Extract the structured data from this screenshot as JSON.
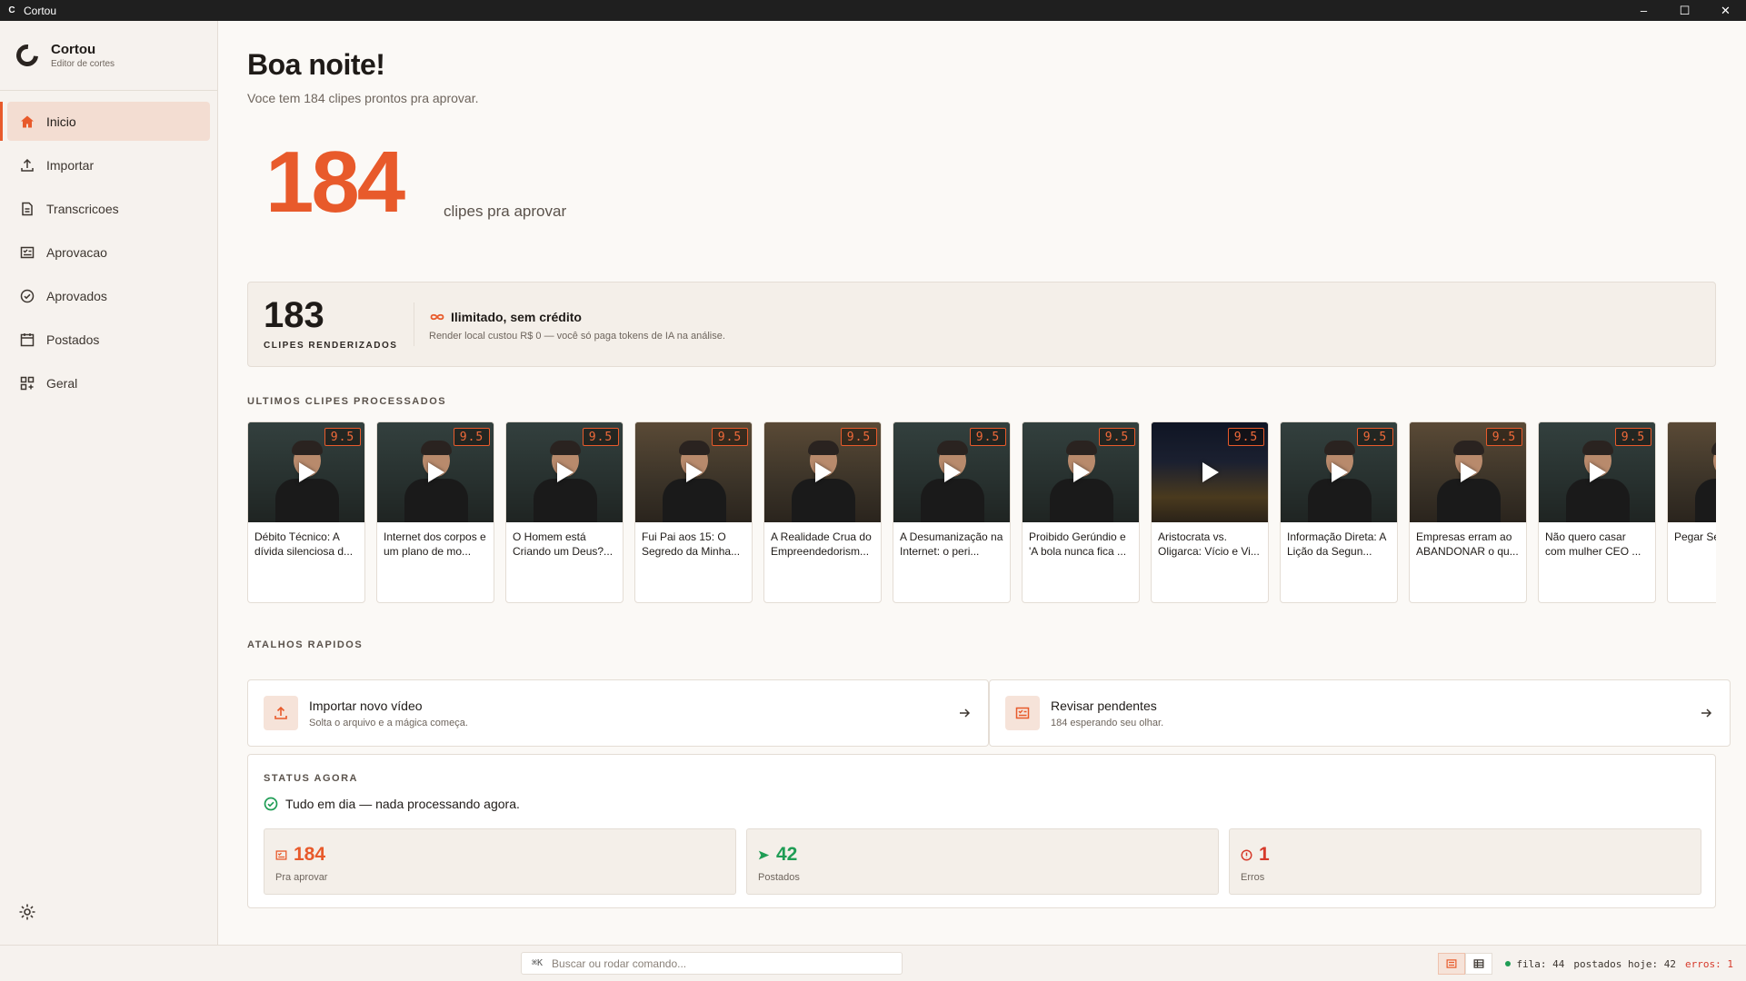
{
  "window": {
    "title": "Cortou",
    "app_icon_letter": "C"
  },
  "brand": {
    "name": "Cortou",
    "subtitle": "Editor de cortes"
  },
  "nav": [
    {
      "label": "Inicio",
      "icon": "home-icon",
      "active": true
    },
    {
      "label": "Importar",
      "icon": "upload-icon",
      "active": false
    },
    {
      "label": "Transcricoes",
      "icon": "document-icon",
      "active": false
    },
    {
      "label": "Aprovacao",
      "icon": "review-icon",
      "active": false
    },
    {
      "label": "Aprovados",
      "icon": "check-circle-icon",
      "active": false
    },
    {
      "label": "Postados",
      "icon": "calendar-icon",
      "active": false
    },
    {
      "label": "Geral",
      "icon": "grid-icon",
      "active": false
    }
  ],
  "greeting": {
    "title": "Boa noite!",
    "subtitle": "Voce tem 184 clipes prontos pra aprovar."
  },
  "hero": {
    "count": "184",
    "label": "clipes pra aprovar"
  },
  "render": {
    "count": "183",
    "label": "CLIPES RENDERIZADOS",
    "title": "Ilimitado, sem crédito",
    "description": "Render local custou R$ 0 — você só paga tokens de IA na análise."
  },
  "recent": {
    "label": "ULTIMOS CLIPES PROCESSADOS",
    "clips": [
      {
        "title": "Débito Técnico: A dívida silenciosa d...",
        "score": "9.5",
        "scene": "dark"
      },
      {
        "title": "Internet dos corpos e um plano de mo...",
        "score": "9.5",
        "scene": "dark"
      },
      {
        "title": "O Homem está Criando um Deus?...",
        "score": "9.5",
        "scene": "dark"
      },
      {
        "title": "Fui Pai aos 15: O Segredo da Minha...",
        "score": "9.5",
        "scene": "warm"
      },
      {
        "title": "A Realidade Crua do Empreendedorism...",
        "score": "9.5",
        "scene": "warm"
      },
      {
        "title": "A Desumanização na Internet: o peri...",
        "score": "9.5",
        "scene": "dark"
      },
      {
        "title": "Proibido Gerúndio e 'A bola nunca fica ...",
        "score": "9.5",
        "scene": "dark"
      },
      {
        "title": "Aristocrata vs. Oligarca: Vício e Vi...",
        "score": "9.5",
        "scene": "room"
      },
      {
        "title": "Informação Direta: A Lição da Segun...",
        "score": "9.5",
        "scene": "dark"
      },
      {
        "title": "Empresas erram ao ABANDONAR o qu...",
        "score": "9.5",
        "scene": "warm"
      },
      {
        "title": "Não quero casar com mulher CEO ...",
        "score": "9.5",
        "scene": "dark"
      },
      {
        "title": "Pegar Se Brasil en",
        "score": "9.5",
        "scene": "warm"
      }
    ]
  },
  "shortcuts": {
    "label": "ATALHOS RAPIDOS",
    "items": [
      {
        "title": "Importar novo vídeo",
        "subtitle": "Solta o arquivo e a mágica começa."
      },
      {
        "title": "Revisar pendentes",
        "subtitle": "184 esperando seu olhar."
      }
    ]
  },
  "status": {
    "label": "STATUS AGORA",
    "message": "Tudo em dia — nada processando agora.",
    "stats": [
      {
        "value": "184",
        "label": "Pra aprovar",
        "color": "#e85a2b"
      },
      {
        "value": "42",
        "label": "Postados",
        "color": "#1f9d55"
      },
      {
        "value": "1",
        "label": "Erros",
        "color": "#d63a2b"
      }
    ]
  },
  "statusbar": {
    "shortcut": "⌘K",
    "placeholder": "Buscar ou rodar comando...",
    "queue": "fila: 44",
    "posted_today": "postados hoje: 42",
    "errors": "erros: 1"
  },
  "colors": {
    "accent": "#e85a2b",
    "success": "#1f9d55",
    "error": "#d63a2b"
  }
}
